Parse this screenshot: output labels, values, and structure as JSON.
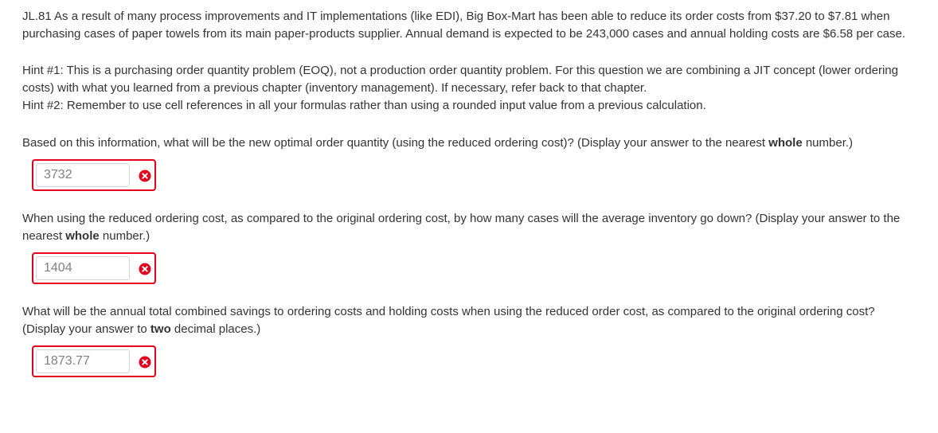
{
  "problem": {
    "intro": "JL.81  As a result of many process improvements and IT implementations (like EDI), Big Box-Mart has been able to reduce its order costs from $37.20 to $7.81 when purchasing cases of paper towels from its main paper-products supplier. Annual demand is expected to be 243,000 cases and annual holding costs are $6.58 per case.",
    "hint1": "Hint #1: This is a purchasing order quantity problem (EOQ), not a production order quantity problem. For this question we are combining a JIT concept (lower ordering costs) with what you learned from a previous chapter (inventory management).  If necessary, refer back to that chapter.",
    "hint2": "Hint #2: Remember to use cell references in all your formulas rather than using a rounded input value from a previous calculation."
  },
  "questions": [
    {
      "text_before": "Based on this information, what will be the new optimal order quantity (using the reduced ordering cost)? (Display your answer to the nearest ",
      "emphasis": "whole",
      "text_after": " number.)",
      "answer": "3732",
      "status_icon": "error-x-icon"
    },
    {
      "text_before": "When using the reduced ordering cost, as compared to the original ordering cost, by how many cases will the average inventory go down? (Display your answer to the nearest ",
      "emphasis": "whole",
      "text_after": " number.)",
      "answer": "1404",
      "status_icon": "error-x-icon"
    },
    {
      "text_before": "What will be the annual total combined savings to ordering costs and holding costs when using the reduced order cost, as compared to the original ordering cost? (Display your answer to ",
      "emphasis": "two",
      "text_after": " decimal places.)",
      "answer": "1873.77",
      "status_icon": "error-x-icon"
    }
  ],
  "colors": {
    "error_border": "#e2001a",
    "error_icon": "#e2001a",
    "text": "#333333",
    "answer_text": "#808080"
  }
}
